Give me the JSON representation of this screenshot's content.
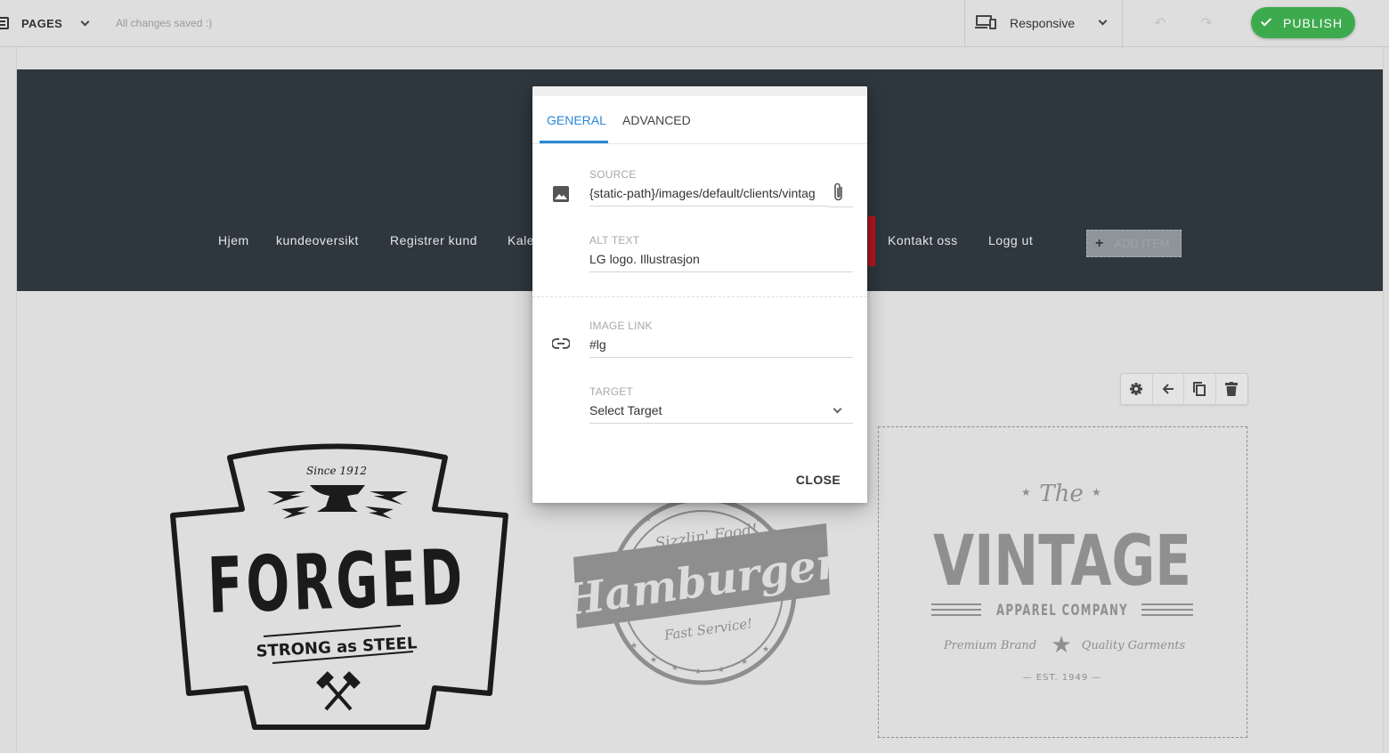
{
  "toolbar": {
    "pages_label": "PAGES",
    "save_status": "All changes saved :)",
    "device_label": "Responsive",
    "publish_label": "PUBLISH",
    "undo_glyph": "↶",
    "redo_glyph": "↷"
  },
  "site": {
    "nav_items": [
      "Hjem",
      "kundeoversikt",
      "Registrer kund",
      "Kale",
      "Kontakt oss",
      "Logg ut"
    ],
    "add_item_label": "ADD ITEM",
    "add_item_glyph": "+"
  },
  "element_toolbar": {
    "buttons": [
      "gear-icon",
      "arrow-left-icon",
      "copy-icon",
      "trash-icon"
    ]
  },
  "modal": {
    "tabs": [
      "GENERAL",
      "ADVANCED"
    ],
    "active_tab": "GENERAL",
    "source": {
      "label": "SOURCE",
      "value": "{static-path}/images/default/clients/vintag"
    },
    "alt_text": {
      "label": "ALT TEXT",
      "value": "LG logo. Illustrasjon"
    },
    "image_link": {
      "label": "IMAGE LINK",
      "value": "#lg"
    },
    "target": {
      "label": "TARGET",
      "value": "Select Target"
    },
    "close_label": "CLOSE"
  },
  "logos": {
    "forged": {
      "since": "Since 1912",
      "main": "FORGED",
      "tagline": "STRONG as STEEL"
    },
    "hamburger": {
      "top": "Sizzlin' Food!",
      "main": "Hamburger",
      "bottom": "Fast Service!"
    },
    "vintage": {
      "the": "The",
      "main": "VINTAGE",
      "company": "APPAREL COMPANY",
      "left": "Premium Brand",
      "right": "Quality Garments",
      "est": "— EST. 1949 —"
    }
  },
  "colors": {
    "publish": "#3daa4e",
    "header_bg": "#2e363e",
    "accent_tab": "#2a88d8",
    "nav_active_bar": "#b5141c"
  }
}
